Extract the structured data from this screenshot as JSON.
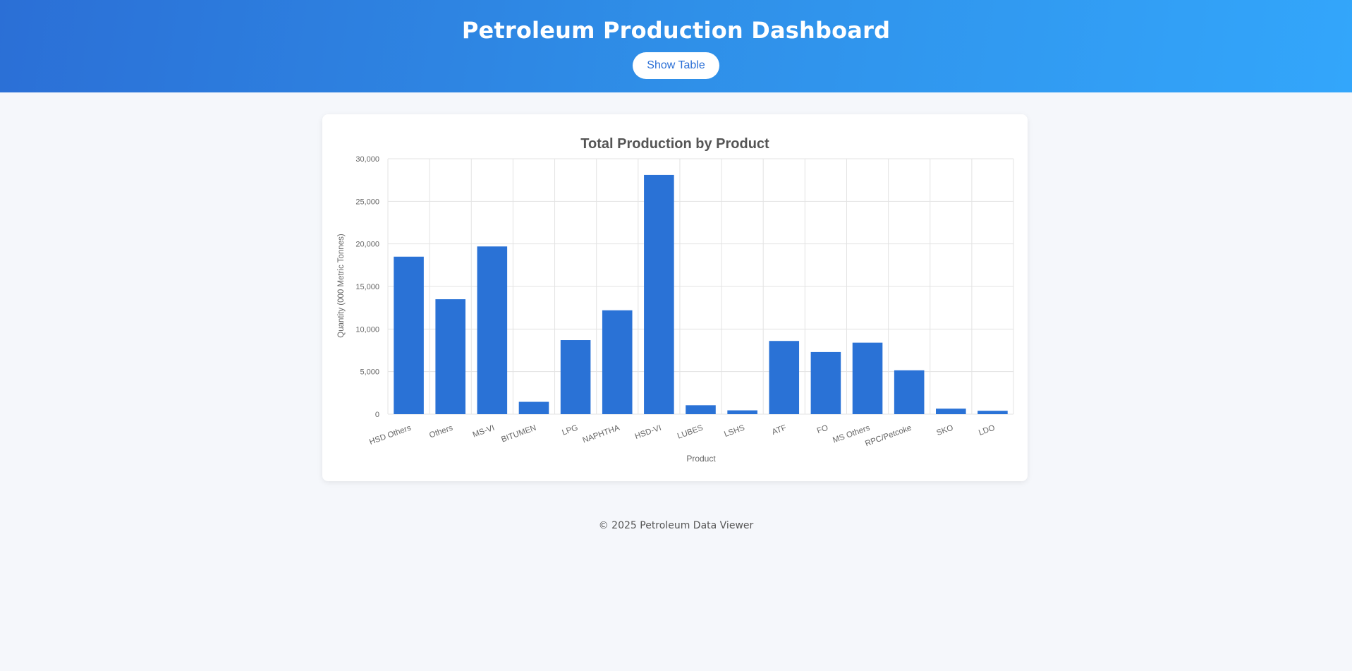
{
  "header": {
    "title": "Petroleum Production Dashboard",
    "toggle_label": "Show Table"
  },
  "colors": {
    "bar": "#2a72d6",
    "grid": "#e3e3e3",
    "axis_text": "#666666",
    "title_text": "#555555"
  },
  "chart_data": {
    "type": "bar",
    "title": "Total Production by Product",
    "xlabel": "Product",
    "ylabel": "Quantity (000 Metric Tonnes)",
    "ylim": [
      0,
      30000
    ],
    "yticks": [
      0,
      5000,
      10000,
      15000,
      20000,
      25000,
      30000
    ],
    "ytick_labels": [
      "0",
      "5,000",
      "10,000",
      "15,000",
      "20,000",
      "25,000",
      "30,000"
    ],
    "grid": true,
    "categories": [
      "HSD Others",
      "Others",
      "MS-VI",
      "BITUMEN",
      "LPG",
      "NAPHTHA",
      "HSD-VI",
      "LUBES",
      "LSHS",
      "ATF",
      "FO",
      "MS Others",
      "RPC/Petcoke",
      "SKO",
      "LDO"
    ],
    "values": [
      18500,
      13500,
      19700,
      1450,
      8700,
      12200,
      28100,
      1050,
      450,
      8600,
      7300,
      8400,
      5150,
      650,
      400
    ]
  },
  "footer": {
    "text": "© 2025 Petroleum Data Viewer"
  }
}
